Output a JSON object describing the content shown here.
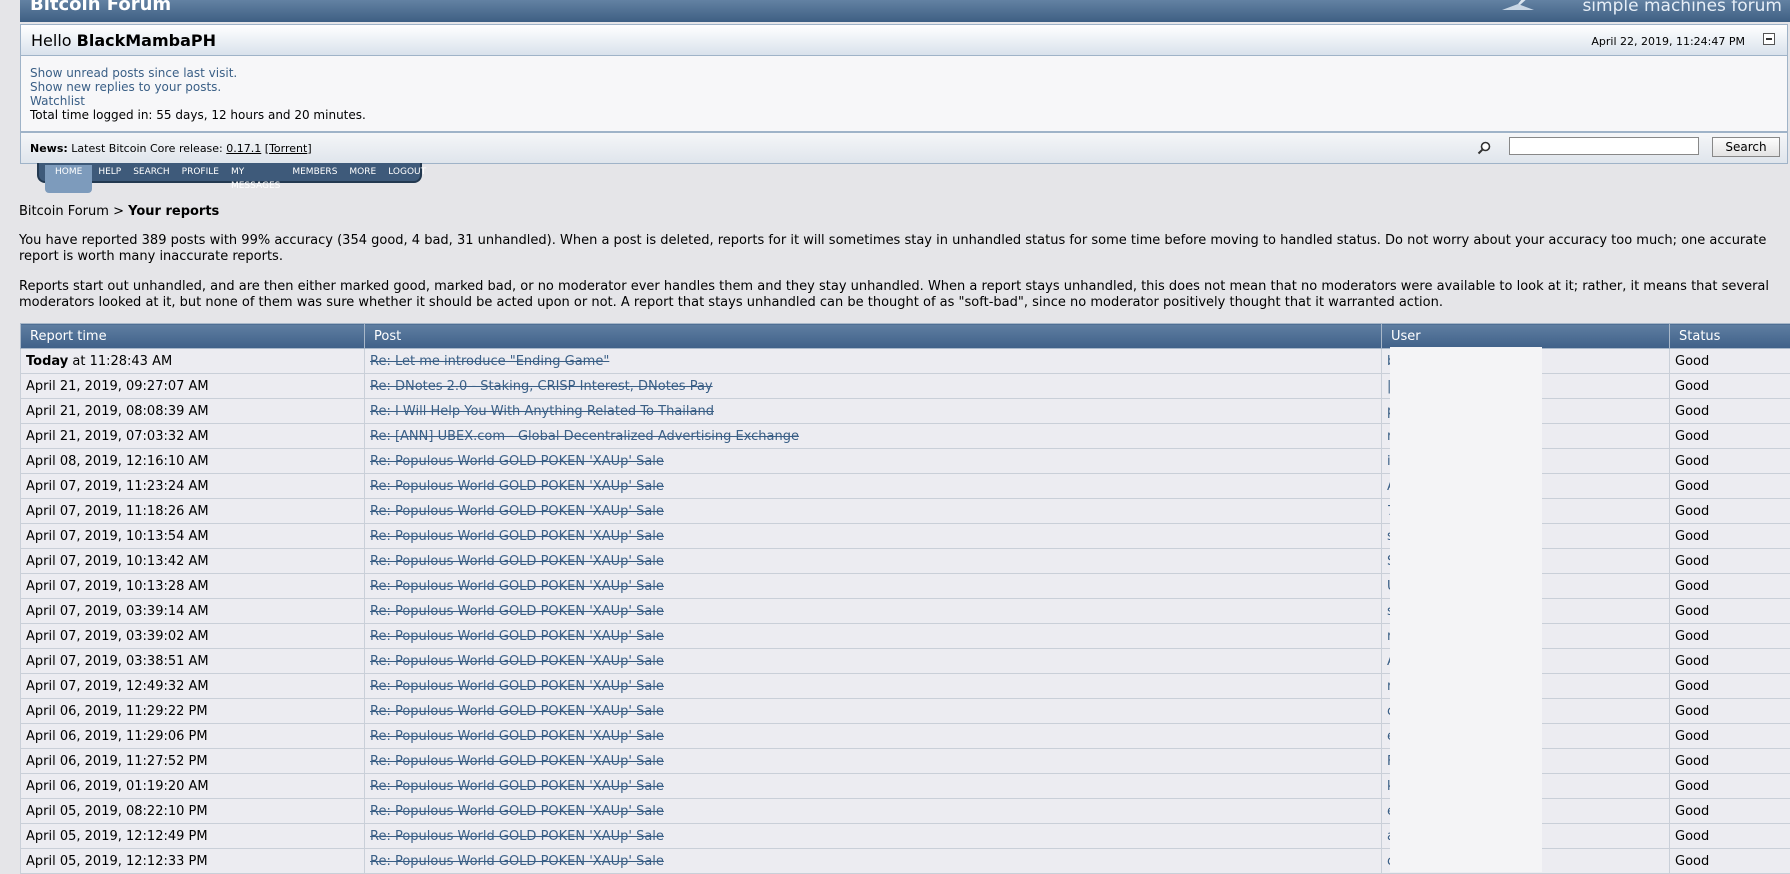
{
  "banner": {
    "title": "Bitcoin Forum",
    "smf_text": "simple machines forum"
  },
  "user": {
    "greeting": "Hello",
    "username": "BlackMambaPH",
    "datetime": "April 22, 2019, 11:24:47 PM"
  },
  "links": {
    "unread": "Show unread posts since last visit.",
    "replies": "Show new replies to your posts.",
    "watchlist": "Watchlist",
    "total_time": "Total time logged in: 55 days, 12 hours and 20 minutes."
  },
  "news": {
    "label": "News:",
    "text": "Latest Bitcoin Core release:",
    "version": "0.17.1",
    "torrent_open": "[",
    "torrent": "Torrent",
    "torrent_close": "]"
  },
  "search": {
    "button": "Search",
    "value": ""
  },
  "menu": [
    "HOME",
    "HELP",
    "SEARCH",
    "PROFILE",
    "MY MESSAGES",
    "MEMBERS",
    "MORE",
    "LOGOUT"
  ],
  "breadcrumb": {
    "root": "Bitcoin Forum",
    "sep": ">",
    "current": "Your reports"
  },
  "intro": {
    "p1": "You have reported 389 posts with 99% accuracy (354 good, 4 bad, 31 unhandled). When a post is deleted, reports for it will sometimes stay in unhandled status for some time before moving to handled status. Do not worry about your accuracy too much; one accurate report is worth many inaccurate reports.",
    "p2": "Reports start out unhandled, and are then either marked good, marked bad, or no moderator ever handles them and they stay unhandled. When a report stays unhandled, this does not mean that no moderators were available to look at it; rather, it means that several moderators looked at it, but none of them was sure whether it should be acted upon or not. A report that stays unhandled can be thought of as \"soft-bad\", since no moderator positively thought that it warranted action."
  },
  "table": {
    "headers": [
      "Report time",
      "Post",
      "User",
      "Status"
    ],
    "first_time_bold": "Today",
    "first_time_rest": " at 11:28:43 AM",
    "rows": [
      {
        "time": "",
        "post": "Re: Let me introduce \"Ending Game\"",
        "user": "b",
        "status": "Good"
      },
      {
        "time": "April 21, 2019, 09:27:07 AM",
        "post": "Re: DNotes 2.0 - Staking, CRISP Interest, DNotes Pay",
        "user": "|",
        "status": "Good"
      },
      {
        "time": "April 21, 2019, 08:08:39 AM",
        "post": "Re: I Will Help You With Anything Related To Thailand",
        "user": "p",
        "status": "Good"
      },
      {
        "time": "April 21, 2019, 07:03:32 AM",
        "post": "Re: [ANN] UBEX.com - Global Decentralized Advertising Exchange",
        "user": "r",
        "status": "Good"
      },
      {
        "time": "April 08, 2019, 12:16:10 AM",
        "post": "Re: Populous World GOLD POKEN 'XAUp' Sale",
        "user": "i",
        "status": "Good"
      },
      {
        "time": "April 07, 2019, 11:23:24 AM",
        "post": "Re: Populous World GOLD POKEN 'XAUp' Sale",
        "user": "A",
        "status": "Good"
      },
      {
        "time": "April 07, 2019, 11:18:26 AM",
        "post": "Re: Populous World GOLD POKEN 'XAUp' Sale",
        "user": "7",
        "status": "Good"
      },
      {
        "time": "April 07, 2019, 10:13:54 AM",
        "post": "Re: Populous World GOLD POKEN 'XAUp' Sale",
        "user": "s",
        "status": "Good"
      },
      {
        "time": "April 07, 2019, 10:13:42 AM",
        "post": "Re: Populous World GOLD POKEN 'XAUp' Sale",
        "user": "S",
        "status": "Good"
      },
      {
        "time": "April 07, 2019, 10:13:28 AM",
        "post": "Re: Populous World GOLD POKEN 'XAUp' Sale",
        "user": "U",
        "status": "Good"
      },
      {
        "time": "April 07, 2019, 03:39:14 AM",
        "post": "Re: Populous World GOLD POKEN 'XAUp' Sale",
        "user": "s",
        "status": "Good"
      },
      {
        "time": "April 07, 2019, 03:39:02 AM",
        "post": "Re: Populous World GOLD POKEN 'XAUp' Sale",
        "user": "r",
        "status": "Good"
      },
      {
        "time": "April 07, 2019, 03:38:51 AM",
        "post": "Re: Populous World GOLD POKEN 'XAUp' Sale",
        "user": "A",
        "status": "Good"
      },
      {
        "time": "April 07, 2019, 12:49:32 AM",
        "post": "Re: Populous World GOLD POKEN 'XAUp' Sale",
        "user": "r",
        "status": "Good"
      },
      {
        "time": "April 06, 2019, 11:29:22 PM",
        "post": "Re: Populous World GOLD POKEN 'XAUp' Sale",
        "user": "c",
        "status": "Good"
      },
      {
        "time": "April 06, 2019, 11:29:06 PM",
        "post": "Re: Populous World GOLD POKEN 'XAUp' Sale",
        "user": "e",
        "status": "Good"
      },
      {
        "time": "April 06, 2019, 11:27:52 PM",
        "post": "Re: Populous World GOLD POKEN 'XAUp' Sale",
        "user": "F",
        "status": "Good"
      },
      {
        "time": "April 06, 2019, 01:19:20 AM",
        "post": "Re: Populous World GOLD POKEN 'XAUp' Sale",
        "user": "k",
        "status": "Good"
      },
      {
        "time": "April 05, 2019, 08:22:10 PM",
        "post": "Re: Populous World GOLD POKEN 'XAUp' Sale",
        "user": "e",
        "status": "Good"
      },
      {
        "time": "April 05, 2019, 12:12:49 PM",
        "post": "Re: Populous World GOLD POKEN 'XAUp' Sale",
        "user": "a",
        "status": "Good"
      },
      {
        "time": "April 05, 2019, 12:12:33 PM",
        "post": "Re: Populous World GOLD POKEN 'XAUp' Sale",
        "user": "c",
        "status": "Good"
      }
    ]
  },
  "colors": {
    "header": "#476890",
    "link": "#3a5f86",
    "row": "#ececf1",
    "page_bg": "#e5e5e8"
  }
}
